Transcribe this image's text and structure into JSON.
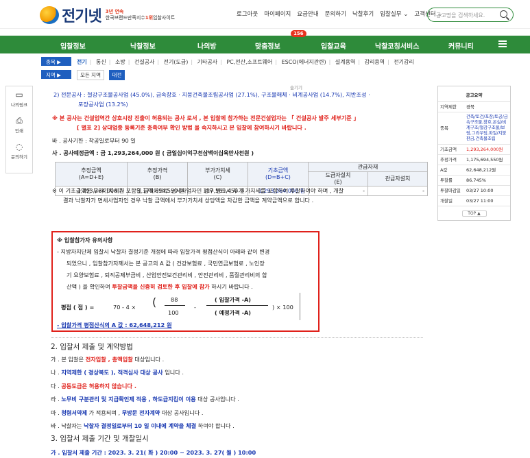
{
  "header": {
    "logo_text": "전기넷",
    "logo_sub1": "3년 연속",
    "logo_sub2_pre": "한국브랜드만족지수",
    "logo_sub2_rank": "1위",
    "logo_sub2_post": "입찰사이트",
    "links": [
      "로그아웃",
      "마이페이지",
      "요금안내",
      "문의하기",
      "낙찰후기",
      "입찰실무 ⌄",
      "고객센터 ⌄"
    ],
    "search_placeholder": "공고명을 검색하세요."
  },
  "nav": {
    "items": [
      "입찰정보",
      "낙찰정보",
      "나의방",
      "맞춤정보",
      "입찰교육",
      "낙찰코칭서비스",
      "커뮤니티"
    ],
    "badge": "156"
  },
  "categories": {
    "type_label": "종목 ▶",
    "types": [
      "전기",
      "통신",
      "소방",
      "건설공사",
      "전기(도급)",
      "기타공사",
      "PC,전산,소프트웨어",
      "ESCO(에너지관련)",
      "설계용역",
      "감리용역",
      "전기감리"
    ],
    "region_label": "지역 ▶",
    "regions": [
      "모든 지역",
      "대전"
    ]
  },
  "leftbar": {
    "items": [
      "나의링크",
      "인쇄",
      "문의하기"
    ]
  },
  "tooltip": "숨기기",
  "content": {
    "line1a": "2) 전문공사 : 철강구조물공사업 (45.0%), 금속창호 · 지붕건축물조립공사업 (27.1%), 구조물해체 · 비계공사업 (14.7%), 지반조성 ·",
    "line1b": "포장공사업 (13.2%)",
    "line2a": "※ 본 공사는 건설업역간 상호시장 진출이 허용되는 공사 로서 , 본 입찰에 참가하는 전문건설업자는 「 건설공사 발주 세부기준 」",
    "line2b": "[ 별표 2] 상대업종 등록기준 충족여부 확인 방법 을 숙지하시고 본 입찰에 참여하시기 바랍니다 .",
    "line3": "바 . 공사기한 : 착공일로부터 90 일",
    "line4": "사 . 공사예정금액 : 금 1,293,264,000 원 ( 금일십이억구천삼백이십육만사천원 )",
    "table": {
      "headers": [
        "추정금액\n(A=D+E)",
        "추정가격\n(B)",
        "부가가치세\n(C)",
        "기초금액\n(D=B+C)",
        "관급자재",
        "도급자설치\n(E)",
        "관급자설치"
      ],
      "row": [
        "1,293,264,000 원",
        "1,175,694,550 원",
        "117,569,450 원",
        "1,293,264,000 원",
        "-",
        "-"
      ]
    },
    "note1a": "※ 이 기초금액은 부가가치세가 포함된 금액이므로 면세사업자인 경우 반드시 부가 가치세를 포함하여 투찰하여야 하며 , 개찰",
    "note1b": "결과 낙찰자가 면세사업자인 경우 낙찰 금액에서 부가가치세 상당액을 차감한 금액을 계약금액으로 합니다 .",
    "notice_title": "※ 입찰참가자 유의사항",
    "notice_l1": "- 지방자치단체 입찰시 낙찰자 결정기준 개정에 따라 입찰가격 평점산식이 아래와 같이 변경",
    "notice_l2": "되었으니 , 입찰참가자께서는 본 공고의 A 값 ( 건강보험료 , 국민연금보험료 , 노인장",
    "notice_l3": "기 요양보험료 , 퇴직공제부금비 , 산업안전보건관리비 , 안전관리비 , 품질관리비의 합",
    "notice_l4_pre": "산액 ) 을 확인하여",
    "notice_l4_red": "투찰금액을 신중히 검토한 후 입찰에 참가",
    "notice_l4_post": "하시기 바랍니다 .",
    "formula": {
      "left": "평점 ( 점 ) =",
      "mid": "70 - 4 ×",
      "n1": "88",
      "d1": "100",
      "minus": "-",
      "n2": "( 입찰가격 -A)",
      "d2": "( 예정가격 -A)",
      "right": ") × 100"
    },
    "notice_last": "- 입찰가격 평점산식의 A 값 : 62,648,212 원",
    "sec2": "2. 입찰서 제출 및 계약방법",
    "ga_pre": "가 . 본 입찰은",
    "ga_b": "전자입찰 , 총액입찰",
    "ga_post": "대상입니다 .",
    "na_pre": "나 .",
    "na_b": "지역제한 ( 경상북도 ), 적격심사 대상 공사",
    "na_post": "입니다 .",
    "da_pre": "다 .",
    "da_b": "공동도급은 허용하지 않습니다 .",
    "ra_pre": "라 .",
    "ra_b": "노무비 구분관리 및 지급확인제 적용 , 하도급지킴이 이용",
    "ra_post": "대상 공사입니다 .",
    "ma_pre": "마 .",
    "ma_b1": "청렴서약제",
    "ma_mid": "가 적용되며 ,",
    "ma_b2": "무방문 전자계약",
    "ma_post": "대상 공사입니다 .",
    "ba_pre": "바 . 낙찰자는",
    "ba_b": "낙찰자 결정일로부터 10 일 이내에 계약을 체결",
    "ba_post": "하여야 합니다 .",
    "sec3": "3. 입찰서 제출 기간 및 개찰일시",
    "last_line": "가 . 입찰서 제출 기간 : 2023. 3. 21( 화 ) 20:00 ~ 2023. 3. 27( 월 ) 10:00"
  },
  "sidebox": {
    "title": "공고요약",
    "rows": [
      {
        "k": "지역제한",
        "v": "경북"
      },
      {
        "k": "종목",
        "v": "건축/토건/포장/토공/금속구조물,창호,온실/비계구조/철강구조물/보링,그라우팅,파일/지붕판금,건축물조립"
      },
      {
        "k": "기초금액",
        "v": "1,293,264,000원"
      },
      {
        "k": "추정가격",
        "v": "1,175,694,550원"
      },
      {
        "k": "A값",
        "v": "62,648,212원"
      },
      {
        "k": "투찰률",
        "v": "86.745%"
      },
      {
        "k": "투찰마감일",
        "v": "03/27 10:00"
      },
      {
        "k": "개찰일",
        "v": "03/27 11:00"
      }
    ],
    "top_btn": "TOP ▲"
  }
}
